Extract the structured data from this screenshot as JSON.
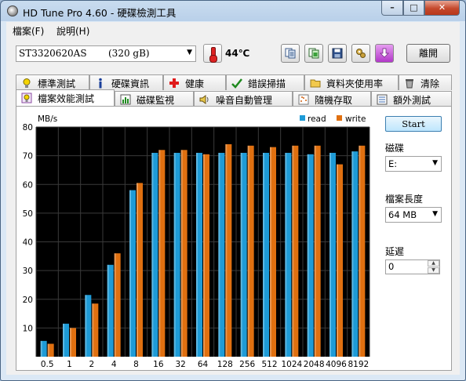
{
  "window": {
    "title": "HD Tune Pro 4.60 - 硬碟檢測工具",
    "controls": {
      "minimize": "–",
      "maximize": "□",
      "close": "✕"
    }
  },
  "menu": [
    "檔案(F)",
    "說明(H)"
  ],
  "toolbar": {
    "drive_name": "ST3320620AS",
    "drive_size": "(320 gB)",
    "temperature": "44℃",
    "exit_label": "離開",
    "icons": [
      "thermometer-icon",
      "copy-text-icon",
      "copy-screenshot-icon",
      "save-icon",
      "options-wrench-icon",
      "download-arrow-icon"
    ]
  },
  "tabs_row1": [
    {
      "label": "標準測試",
      "icon": "bulb-icon"
    },
    {
      "label": "硬碟資訊",
      "icon": "info-icon"
    },
    {
      "label": "健康",
      "icon": "health-cross-icon"
    },
    {
      "label": "錯誤掃描",
      "icon": "scan-check-icon"
    },
    {
      "label": "資料夾使用率",
      "icon": "folder-icon"
    },
    {
      "label": "清除",
      "icon": "trash-icon"
    }
  ],
  "tabs_row2": [
    {
      "label": "檔案效能測試",
      "icon": "file-bulb-icon",
      "active": true
    },
    {
      "label": "磁碟監視",
      "icon": "monitor-chart-icon"
    },
    {
      "label": "噪音自動管理",
      "icon": "speaker-icon"
    },
    {
      "label": "隨機存取",
      "icon": "random-access-icon"
    },
    {
      "label": "額外測試",
      "icon": "extra-test-icon"
    }
  ],
  "controls": {
    "start_label": "Start",
    "disk_label": "磁碟",
    "disk_value": "E:",
    "file_length_label": "檔案長度",
    "file_length_value": "64 MB",
    "delay_label": "延遲",
    "delay_value": "0"
  },
  "colors": {
    "read": "#1e9bd7",
    "write": "#e07010",
    "plot_bg": "#000000"
  },
  "chart_data": {
    "type": "bar",
    "ylabel": "MB/s",
    "ylim": [
      0,
      80
    ],
    "yticks": [
      10,
      20,
      30,
      40,
      50,
      60,
      70,
      80
    ],
    "categories": [
      "0.5",
      "1",
      "2",
      "4",
      "8",
      "16",
      "32",
      "64",
      "128",
      "256",
      "512",
      "1024",
      "2048",
      "4096",
      "8192"
    ],
    "series": [
      {
        "name": "read",
        "values": [
          5.5,
          11.5,
          21.5,
          32,
          58,
          71,
          71,
          71,
          71,
          71,
          71,
          71,
          70.5,
          71,
          71.5
        ]
      },
      {
        "name": "write",
        "values": [
          4.5,
          10,
          18.5,
          36,
          60.5,
          72,
          72,
          70.5,
          74,
          73.5,
          73,
          73.5,
          73.5,
          67,
          73.5
        ]
      }
    ],
    "legend": "top-right",
    "grid": true
  }
}
